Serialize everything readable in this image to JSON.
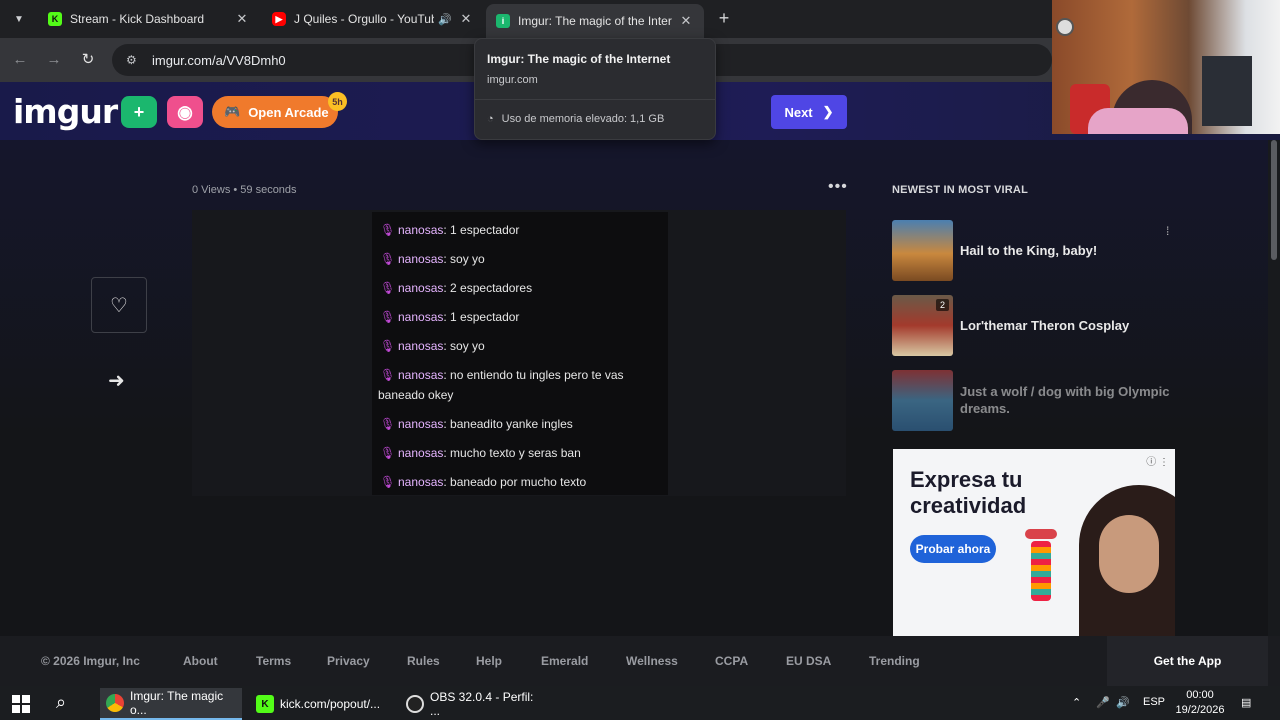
{
  "browser": {
    "tabs": [
      {
        "title": "Stream - Kick Dashboard",
        "favicon": "kick-icon"
      },
      {
        "title": "J Quiles - Orgullo - YouTube",
        "favicon": "youtube-icon"
      },
      {
        "title": "Imgur: The magic of the Internet",
        "favicon": "imgur-icon"
      }
    ],
    "url": "imgur.com/a/VV8Dmh0",
    "hover_card": {
      "title": "Imgur: The magic of the Internet",
      "domain": "imgur.com",
      "memory": "Uso de memoria elevado: 1,1 GB"
    }
  },
  "header": {
    "logo": "imgur",
    "arcade_label": "Open Arcade",
    "arcade_badge": "5h",
    "next_label": "Next"
  },
  "post": {
    "meta": "0 Views • 59 seconds"
  },
  "chat": [
    {
      "user": "nanosas",
      "text": ": 1 espectador"
    },
    {
      "user": "nanosas",
      "text": ": soy yo"
    },
    {
      "user": "nanosas",
      "text": ": 2 espectadores"
    },
    {
      "user": "nanosas",
      "text": ": 1 espectador"
    },
    {
      "user": "nanosas",
      "text": ": soy yo"
    },
    {
      "user": "nanosas",
      "text": ": no entiendo tu ingles pero te vas baneado okey"
    },
    {
      "user": "nanosas",
      "text": ": baneadito yanke ingles"
    },
    {
      "user": "nanosas",
      "text": ": mucho texto y seras ban"
    },
    {
      "user": "nanosas",
      "text": ": baneado por mucho texto"
    }
  ],
  "sidebar": {
    "title": "NEWEST IN MOST VIRAL",
    "items": [
      {
        "title": "Hail to the King, baby!",
        "count": ""
      },
      {
        "title": "Lor'themar Theron Cosplay",
        "count": "2"
      },
      {
        "title": "Just a wolf / dog with big Olympic dreams.",
        "count": ""
      }
    ]
  },
  "ad": {
    "headline": "Expresa tu creatividad",
    "cta": "Probar ahora"
  },
  "footer": {
    "copyright": "© 2026 Imgur, Inc",
    "links": [
      "About",
      "Terms",
      "Privacy",
      "Rules",
      "Help",
      "Emerald",
      "Wellness",
      "CCPA",
      "EU DSA",
      "Trending"
    ],
    "get_app": "Get the App"
  },
  "taskbar": {
    "items": [
      {
        "label": "Imgur: The magic o..."
      },
      {
        "label": "kick.com/popout/..."
      },
      {
        "label": "OBS 32.0.4 - Perfil: ..."
      }
    ],
    "language": "ESP",
    "time": "00:00",
    "date": "19/2/2026"
  }
}
